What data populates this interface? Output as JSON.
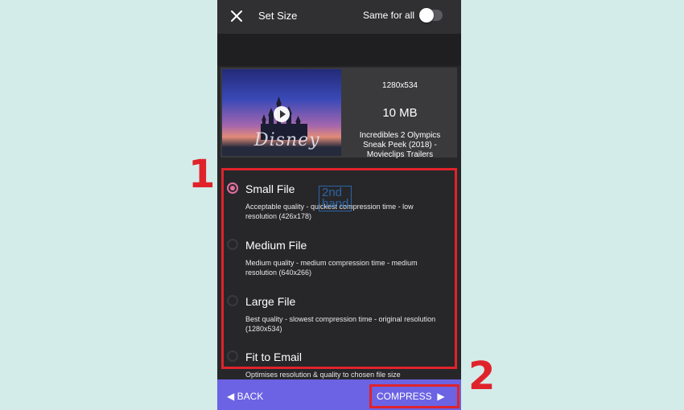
{
  "header": {
    "title": "Set Size",
    "same_for_all_label": "Same for all",
    "same_for_all_on": false
  },
  "media": {
    "resolution": "1280x534",
    "file_size": "10 MB",
    "title": "Incredibles 2 Olympics Sneak Peek (2018) - Movieclips Trailers",
    "thumbnail_logo": "Disney"
  },
  "options": [
    {
      "label": "Small File",
      "description": "Acceptable quality - quickest compression time - low resolution (426x178)",
      "selected": true
    },
    {
      "label": "Medium File",
      "description": "Medium quality - medium compression time - medium resolution (640x266)",
      "selected": false
    },
    {
      "label": "Large File",
      "description": "Best quality - slowest compression time - original resolution (1280x534)",
      "selected": false
    },
    {
      "label": "Fit to Email",
      "description": "Optimises resolution & quality to chosen file size",
      "selected": false
    }
  ],
  "watermark": {
    "line1": "2nd",
    "line2": "hand"
  },
  "footer": {
    "back_label": "BACK",
    "compress_label": "COMPRESS"
  },
  "annotations": {
    "callout_1": "1",
    "callout_2": "2",
    "highlight_color": "#e0232b"
  },
  "colors": {
    "accent_pink": "#e26f9f",
    "bottom_bar": "#6b63e3",
    "background": "#d3ecea"
  }
}
